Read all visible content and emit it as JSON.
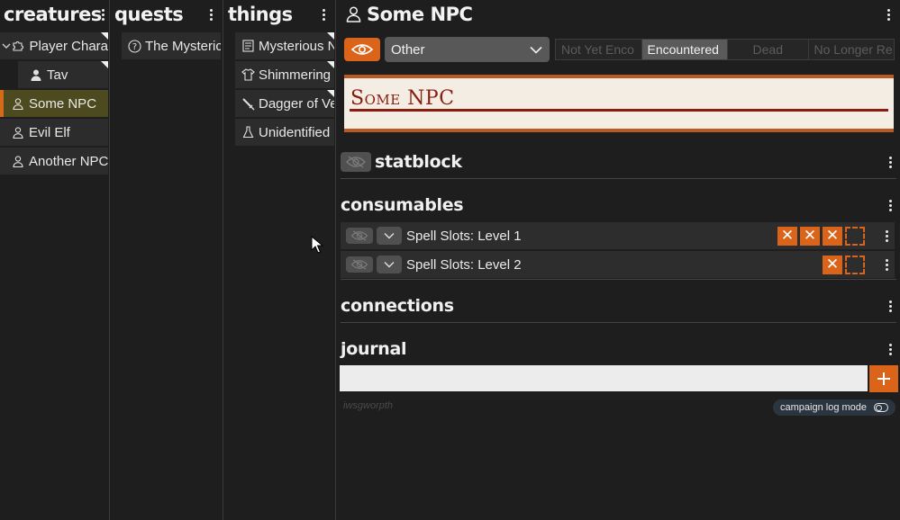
{
  "columns": {
    "creatures": {
      "title": "creatures",
      "items": [
        {
          "label": "Player Chara",
          "icon": "puzzle-icon"
        },
        {
          "label": "Tav",
          "icon": "person-filled-icon"
        },
        {
          "label": "Some NPC",
          "icon": "person-icon",
          "selected": true
        },
        {
          "label": "Evil Elf",
          "icon": "person-icon"
        },
        {
          "label": "Another NPC",
          "icon": "person-icon"
        }
      ]
    },
    "quests": {
      "title": "quests",
      "items": [
        {
          "label": "The Mysteric",
          "icon": "question-circle-icon"
        }
      ]
    },
    "things": {
      "title": "things",
      "items": [
        {
          "label": "Mysterious N",
          "icon": "scroll-icon"
        },
        {
          "label": "Shimmering",
          "icon": "shirt-icon"
        },
        {
          "label": "Dagger of Ve",
          "icon": "dagger-icon"
        },
        {
          "label": "Unidentified",
          "icon": "flask-icon"
        }
      ]
    }
  },
  "detail": {
    "title": "Some NPC",
    "category_select": "Other",
    "status_options": [
      "Not Yet Enco",
      "Encountered",
      "Dead",
      "No Longer Re"
    ],
    "status_active_index": 1,
    "card_name": "Some NPC",
    "sections": {
      "statblock": "statblock",
      "consumables": "consumables",
      "connections": "connections",
      "journal": "journal"
    },
    "consumables": [
      {
        "label": "Spell Slots: Level 1",
        "used": 3,
        "total": 4
      },
      {
        "label": "Spell Slots: Level 2",
        "used": 1,
        "total": 2
      }
    ],
    "journal_hint": "iwsgworpth",
    "log_mode_label": "campaign log mode"
  },
  "colors": {
    "accent": "#d9641a",
    "selected_bg": "#4e4a1f",
    "card_bg": "#f3ede4",
    "card_text": "#8a1d10"
  }
}
